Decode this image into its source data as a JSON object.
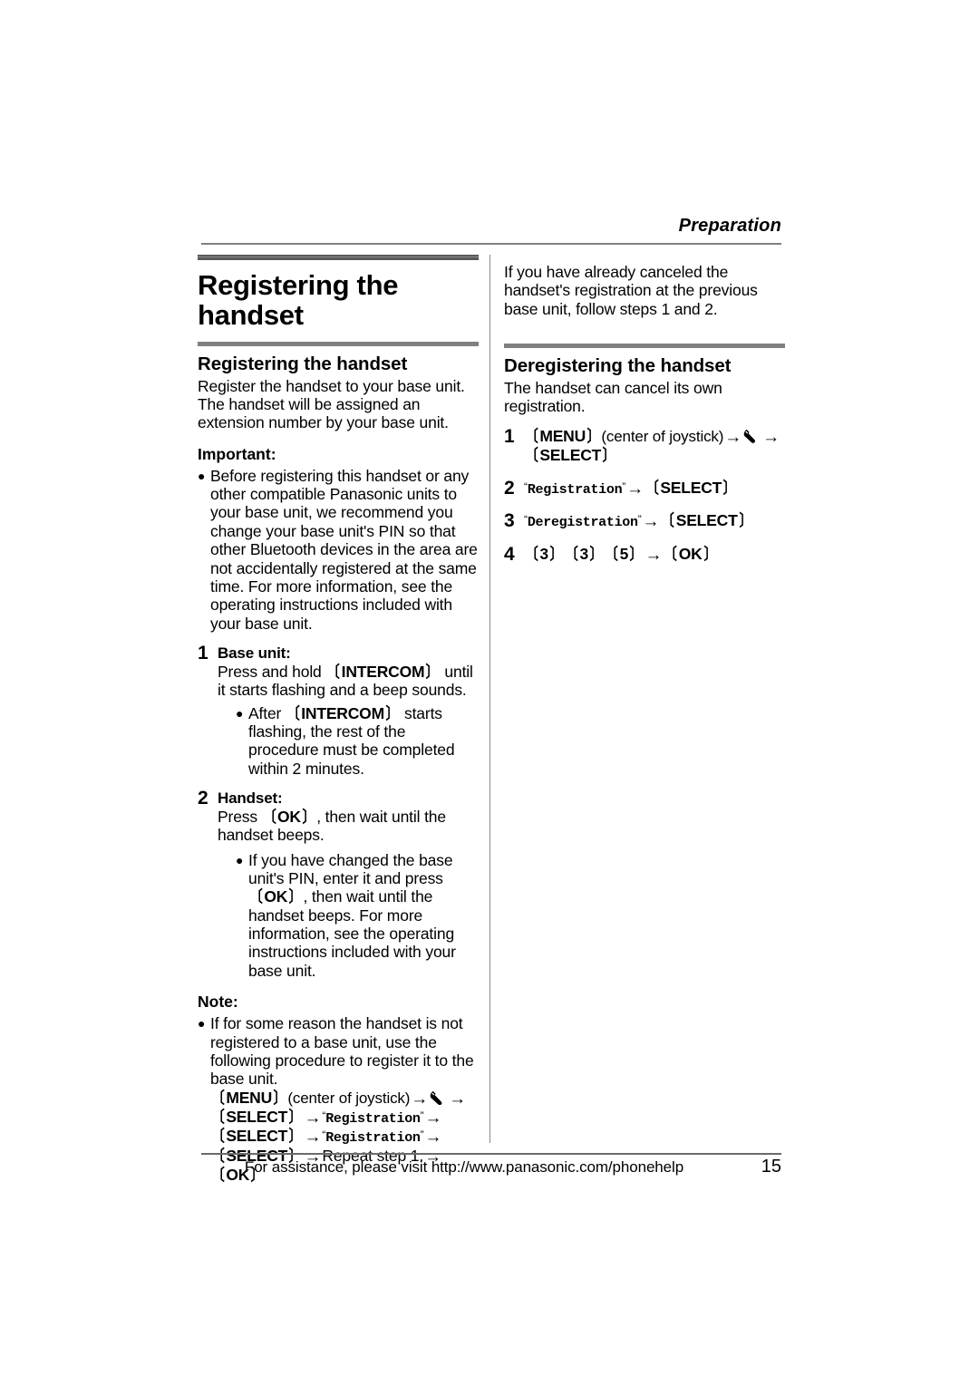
{
  "page": {
    "running_head": "Preparation",
    "footer_text": "For assistance, please visit http://www.panasonic.com/phonehelp",
    "page_number": "15",
    "rule_color": "#808080"
  },
  "left_column": {
    "chapter_title": "Registering the handset",
    "section_title": "Registering the handset",
    "intro": "Register the handset to your base unit. The handset will be assigned an extension number by your base unit.",
    "important_label": "Important:",
    "important_bullet": "Before registering this handset or any other compatible Panasonic units to your base unit, we recommend you change your base unit's PIN so that other Bluetooth devices in the area are not accidentally registered at the same time. For more information, see the operating instructions included with your base unit.",
    "steps": [
      {
        "number": "1",
        "label": "Base unit:",
        "text_before_key": "Press and hold ",
        "key": "INTERCOM",
        "text_after_key": " until it starts flashing and a beep sounds.",
        "bullet_before_key": "After ",
        "bullet_key": "INTERCOM",
        "bullet_after_key": " starts flashing, the rest of the procedure must be completed within 2 minutes."
      },
      {
        "number": "2",
        "label": "Handset:",
        "text_before_key": "Press ",
        "key": "OK",
        "text_after_key": ", then wait until the handset beeps.",
        "bullet_before_key": "If you have changed the base unit's PIN, enter it and press ",
        "bullet_key": "OK",
        "bullet_after_key": ", then wait until the handset beeps. For more information, see the operating instructions included with your base unit."
      }
    ],
    "note_label": "Note:",
    "note_bullet": "If for some reason the handset is not registered to a base unit, use the following procedure to register it to the base unit.",
    "note_sequence": {
      "key_menu": "MENU",
      "joystick_text": "(center of joystick)",
      "icon": "wrench-icon",
      "key_select_1": "SELECT",
      "lcd_1": "Registration",
      "key_select_2": "SELECT",
      "lcd_2": "Registration",
      "key_select_3": "SELECT",
      "repeat_text": "Repeat step 1.",
      "key_ok": "OK",
      "arrow": "→"
    }
  },
  "right_column": {
    "lead_paragraph": "If you have already canceled the handset's registration at the previous base unit, follow steps 1 and 2.",
    "section_title": "Deregistering the handset",
    "intro": "The handset can cancel its own registration.",
    "steps": [
      {
        "number": "1",
        "key_menu": "MENU",
        "joystick_text": "(center of joystick)",
        "icon": "wrench-icon",
        "key_select": "SELECT"
      },
      {
        "number": "2",
        "lcd": "Registration",
        "key_select": "SELECT"
      },
      {
        "number": "3",
        "lcd": "Deregistration",
        "key_select": "SELECT"
      },
      {
        "number": "4",
        "digits": [
          "3",
          "3",
          "5"
        ],
        "key_ok": "OK"
      }
    ]
  },
  "glyphs": {
    "arrow": "→",
    "bullet": "●",
    "bracket_open": "〔",
    "bracket_close": "〕",
    "quote_open": "“",
    "quote_close": "”"
  }
}
